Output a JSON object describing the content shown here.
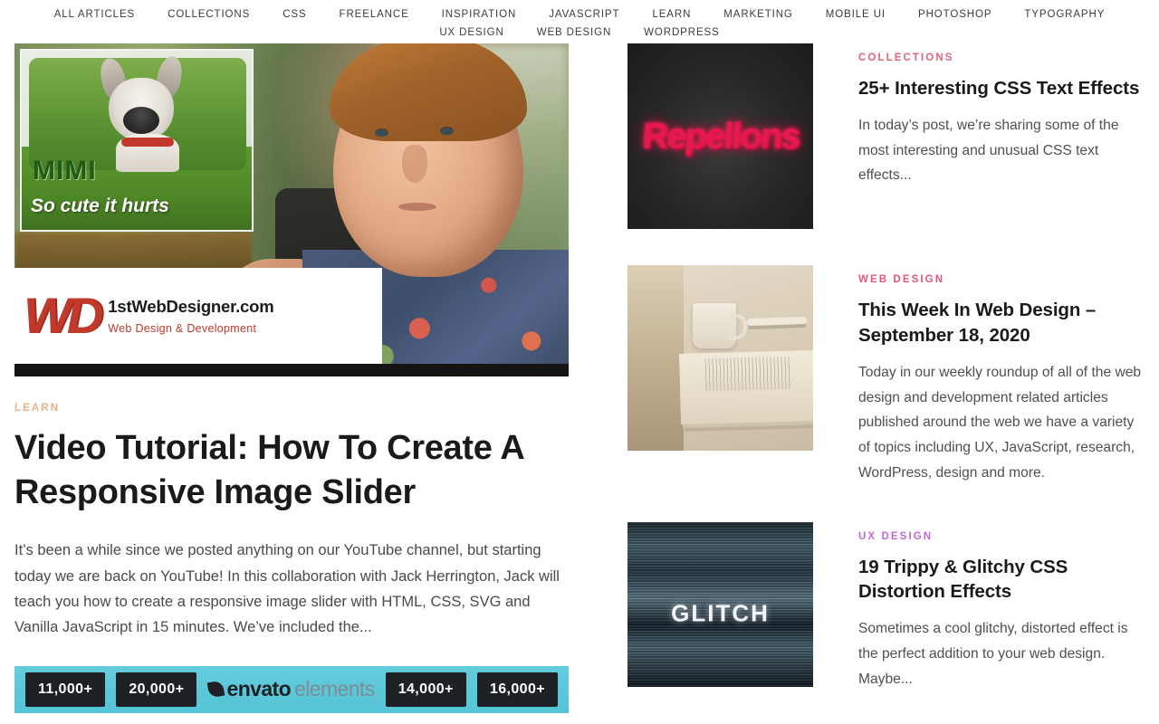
{
  "nav": {
    "items": [
      {
        "label": "ALL ARTICLES"
      },
      {
        "label": "COLLECTIONS"
      },
      {
        "label": "CSS"
      },
      {
        "label": "FREELANCE"
      },
      {
        "label": "INSPIRATION"
      },
      {
        "label": "JAVASCRIPT"
      },
      {
        "label": "LEARN"
      },
      {
        "label": "MARKETING"
      },
      {
        "label": "MOBILE UI"
      },
      {
        "label": "PHOTOSHOP"
      },
      {
        "label": "TYPOGRAPHY"
      },
      {
        "label": "UX DESIGN"
      },
      {
        "label": "WEB DESIGN"
      },
      {
        "label": "WORDPRESS"
      }
    ]
  },
  "featured": {
    "image": {
      "poster_name": "MIMI",
      "poster_tagline": "So cute it hurts",
      "brand_logo_text": "WD",
      "brand_title": "1stWebDesigner.com",
      "brand_subtitle": "Web Design & Development"
    },
    "category": "LEARN",
    "category_color": "#eab186",
    "title": "Video Tutorial: How To Create A Responsive Image Slider",
    "excerpt": "It’s been a while since we posted anything on our YouTube channel, but starting today we are back on YouTube! In this collaboration with Jack Herrington, Jack will teach you how to create a responsive image slider with HTML, CSS, SVG and Vanilla JavaScript in 15 minutes. We’ve included the..."
  },
  "banner": {
    "chip_1": "11,000+",
    "chip_2": "20,000+",
    "logo_envato": "envato",
    "logo_elements": "elements",
    "chip_3": "14,000+",
    "chip_4": "16,000+",
    "background_color": "#55c3d6"
  },
  "sidebar": {
    "cards": [
      {
        "thumb_text": "Repellons",
        "category": "COLLECTIONS",
        "category_color": "#e4637e",
        "title": "25+ Interesting CSS Text Effects",
        "excerpt": "In today’s post, we’re sharing some of the most interesting and unusual CSS text effects..."
      },
      {
        "thumb_text": "",
        "category": "WEB DESIGN",
        "category_color": "#e0577a",
        "title": "This Week In Web Design – September 18, 2020",
        "excerpt": "Today in our weekly roundup of all of the web design and development related articles published around the web we have a variety of topics including UX, JavaScript, research, WordPress, design and more."
      },
      {
        "thumb_text": "GLITCH",
        "category": "UX DESIGN",
        "category_color": "#c267d6",
        "title": "19 Trippy & Glitchy CSS Distortion Effects",
        "excerpt": "Sometimes a cool glitchy, distorted effect is the perfect addition to your web design. Maybe..."
      }
    ]
  }
}
